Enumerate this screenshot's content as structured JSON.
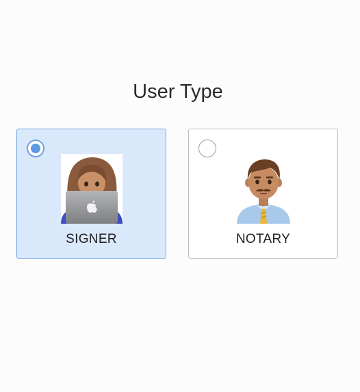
{
  "header": {
    "title": "User Type"
  },
  "options": [
    {
      "label": "SIGNER",
      "selected": true,
      "icon": "woman-technologist-icon"
    },
    {
      "label": "NOTARY",
      "selected": false,
      "icon": "man-office-worker-icon"
    }
  ],
  "colors": {
    "selected_background": "#dae8fb",
    "selected_border": "#6ea2e3",
    "radio_accent": "#5e9ae4",
    "unselected_border": "#b9b9c4"
  }
}
